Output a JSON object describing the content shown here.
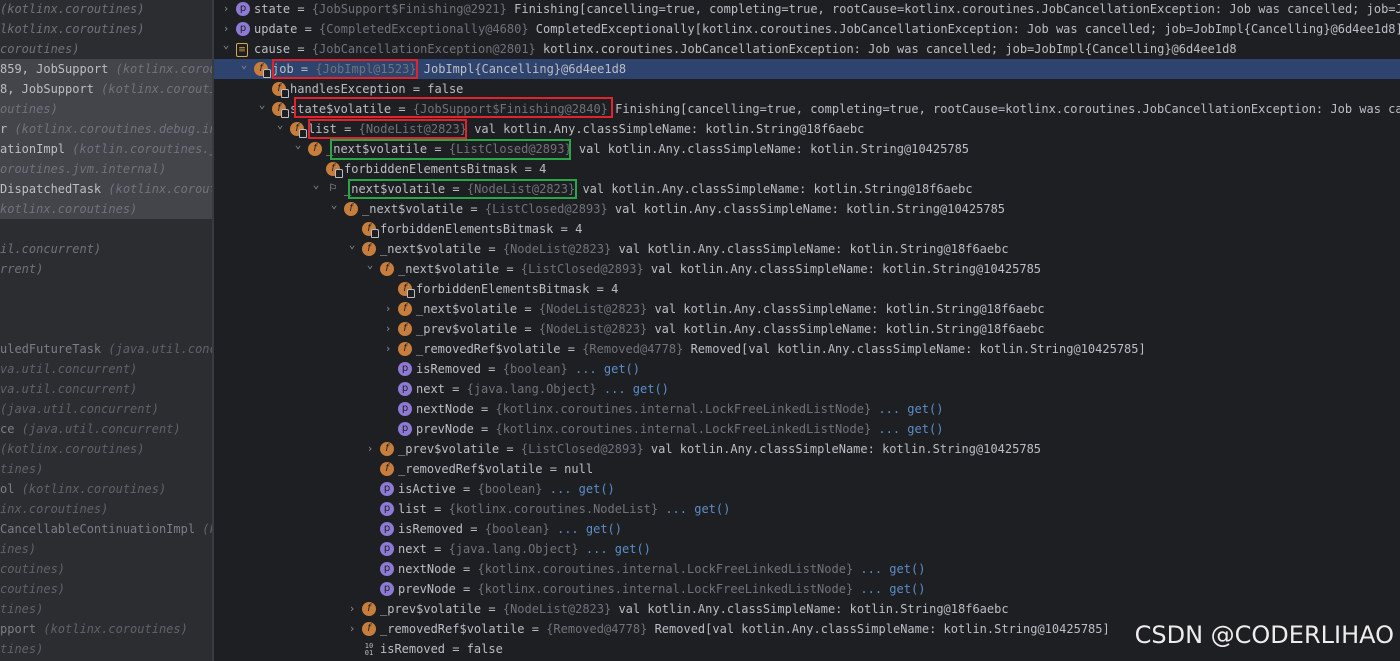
{
  "frames": [
    {
      "text": "",
      "pkg": "(kotlinx.coroutines)",
      "sel": false
    },
    {
      "text": "",
      "pkg": "lkotlinx.coroutines)",
      "sel": false
    },
    {
      "text": "",
      "pkg": "coroutines)",
      "sel": false
    },
    {
      "text": "859, JobSupport ",
      "pkg": "(kotlinx.corout",
      "sel": true
    },
    {
      "text": "8, JobSupport ",
      "pkg": "(kotlinx.corouti",
      "sel": true
    },
    {
      "text": "",
      "pkg": "outines)",
      "sel": true
    },
    {
      "text": "r ",
      "pkg": "(kotlinx.coroutines.debug.int",
      "sel": true
    },
    {
      "text": "ationImpl ",
      "pkg": "(kotlin.coroutines.jv",
      "sel": true
    },
    {
      "text": "",
      "pkg": "oroutines.jvm.internal)",
      "sel": true
    },
    {
      "text": " DispatchedTask ",
      "pkg": "(kotlinx.corout",
      "sel": true
    },
    {
      "text": "",
      "pkg": "kotlinx.coroutines)",
      "sel": true
    },
    {
      "text": "",
      "pkg": "",
      "sel": false
    },
    {
      "text": "",
      "pkg": "il.concurrent)",
      "sel": false
    },
    {
      "text": "",
      "pkg": "rrent)",
      "sel": false
    },
    {
      "text": "",
      "pkg": "",
      "sel": false
    },
    {
      "text": "",
      "pkg": "",
      "sel": false
    },
    {
      "text": "",
      "pkg": "",
      "sel": false
    },
    {
      "text": "uledFutureTask ",
      "pkg": "(java.util.concu",
      "sel": false,
      "lib": true
    },
    {
      "text": "",
      "pkg": "va.util.concurrent)",
      "sel": false,
      "lib": true
    },
    {
      "text": "",
      "pkg": "va.util.concurrent)",
      "sel": false,
      "lib": true
    },
    {
      "text": "",
      "pkg": "(java.util.concurrent)",
      "sel": false,
      "lib": true
    },
    {
      "text": "ce ",
      "pkg": "(java.util.concurrent)",
      "sel": false,
      "lib": true
    },
    {
      "text": " ",
      "pkg": "(kotlinx.coroutines)",
      "sel": false,
      "lib": true
    },
    {
      "text": "",
      "pkg": "tines)",
      "sel": false,
      "lib": true
    },
    {
      "text": "ol ",
      "pkg": "(kotlinx.coroutines)",
      "sel": false,
      "lib": true
    },
    {
      "text": "",
      "pkg": "inx.coroutines)",
      "sel": false,
      "lib": true
    },
    {
      "text": "CancellableContinuationImpl ",
      "pkg": "(ko",
      "sel": false,
      "lib": true
    },
    {
      "text": "",
      "pkg": "ines)",
      "sel": false,
      "lib": true
    },
    {
      "text": "",
      "pkg": "coutines)",
      "sel": false,
      "lib": true
    },
    {
      "text": "",
      "pkg": "coutines)",
      "sel": false,
      "lib": true
    },
    {
      "text": "",
      "pkg": "tines)",
      "sel": false,
      "lib": true
    },
    {
      "text": "pport ",
      "pkg": "(kotlinx.coroutines)",
      "sel": false,
      "lib": true
    },
    {
      "text": "",
      "pkg": "tines)",
      "sel": false,
      "lib": true
    }
  ],
  "rows": [
    {
      "lvl": 0,
      "arr": "›",
      "icon": "p",
      "name": "state",
      "type": "{JobSupport$Finishing@2921}",
      "val": " Finishing[cancelling=true, completing=true, rootCause=kotlinx.coroutines.JobCancellationException: Job was cancelled; job=JobImpl"
    },
    {
      "lvl": 0,
      "arr": "›",
      "icon": "p",
      "name": "update",
      "type": "{CompletedExceptionally@4680}",
      "val": " CompletedExceptionally[kotlinx.coroutines.JobCancellationException: Job was cancelled; job=JobImpl{Cancelling}@6d4ee1d8]"
    },
    {
      "lvl": 0,
      "arr": "⌄",
      "icon": "b",
      "name": "cause",
      "type": "{JobCancellationException@2801}",
      "val": " kotlinx.coroutines.JobCancellationException: Job was cancelled; job=JobImpl{Cancelling}@6d4ee1d8"
    },
    {
      "lvl": 1,
      "arr": "⌄",
      "icon": "fl",
      "name": "job",
      "type": "{JobImpl@1523}",
      "val": " JobImpl{Cancelling}@6d4ee1d8",
      "sel": true
    },
    {
      "lvl": 2,
      "arr": "",
      "icon": "fl",
      "name": "handlesException",
      "type": "",
      "val": " = false"
    },
    {
      "lvl": 2,
      "arr": "⌄",
      "icon": "fl",
      "name": "state$volatile",
      "type": "{JobSupport$Finishing@2840}",
      "val": " Finishing[cancelling=true, completing=true, rootCause=kotlinx.coroutines.JobCancellationException: Job was cance"
    },
    {
      "lvl": 3,
      "arr": "⌄",
      "icon": "fl",
      "name": "list",
      "type": "{NodeList@2823}",
      "val": " val kotlin.Any.classSimpleName: kotlin.String@18f6aebc"
    },
    {
      "lvl": 4,
      "arr": "⌄",
      "icon": "f",
      "name": "_next$volatile",
      "type": "{ListClosed@2893}",
      "val": " val kotlin.Any.classSimpleName: kotlin.String@10425785"
    },
    {
      "lvl": 5,
      "arr": "",
      "icon": "fl",
      "name": "forbiddenElementsBitmask",
      "type": "",
      "val": " = 4"
    },
    {
      "lvl": 5,
      "arr": "⌄",
      "icon": "flag",
      "name": "_next$volatile",
      "type": "{NodeList@2823}",
      "val": " val kotlin.Any.classSimpleName: kotlin.String@18f6aebc"
    },
    {
      "lvl": 6,
      "arr": "⌄",
      "icon": "f",
      "name": "_next$volatile",
      "type": "{ListClosed@2893}",
      "val": " val kotlin.Any.classSimpleName: kotlin.String@10425785"
    },
    {
      "lvl": 7,
      "arr": "",
      "icon": "fl",
      "name": "forbiddenElementsBitmask",
      "type": "",
      "val": " = 4"
    },
    {
      "lvl": 7,
      "arr": "⌄",
      "icon": "f",
      "name": "_next$volatile",
      "type": "{NodeList@2823}",
      "val": " val kotlin.Any.classSimpleName: kotlin.String@18f6aebc"
    },
    {
      "lvl": 8,
      "arr": "⌄",
      "icon": "f",
      "name": "_next$volatile",
      "type": "{ListClosed@2893}",
      "val": " val kotlin.Any.classSimpleName: kotlin.String@10425785"
    },
    {
      "lvl": 9,
      "arr": "",
      "icon": "fl",
      "name": "forbiddenElementsBitmask",
      "type": "",
      "val": " = 4"
    },
    {
      "lvl": 9,
      "arr": "›",
      "icon": "f",
      "name": "_next$volatile",
      "type": "{NodeList@2823}",
      "val": " val kotlin.Any.classSimpleName: kotlin.String@18f6aebc"
    },
    {
      "lvl": 9,
      "arr": "›",
      "icon": "f",
      "name": "_prev$volatile",
      "type": "{NodeList@2823}",
      "val": " val kotlin.Any.classSimpleName: kotlin.String@18f6aebc"
    },
    {
      "lvl": 9,
      "arr": "›",
      "icon": "f",
      "name": "_removedRef$volatile",
      "type": "{Removed@4778}",
      "val": " Removed[val kotlin.Any.classSimpleName: kotlin.String@10425785]"
    },
    {
      "lvl": 9,
      "arr": "",
      "icon": "p",
      "name": "isRemoved",
      "type": "{boolean}",
      "val": "",
      "get": " ... get()"
    },
    {
      "lvl": 9,
      "arr": "",
      "icon": "p",
      "name": "next",
      "type": "{java.lang.Object}",
      "val": "",
      "get": " ... get()"
    },
    {
      "lvl": 9,
      "arr": "",
      "icon": "p",
      "name": "nextNode",
      "type": "{kotlinx.coroutines.internal.LockFreeLinkedListNode}",
      "val": "",
      "get": " ... get()"
    },
    {
      "lvl": 9,
      "arr": "",
      "icon": "p",
      "name": "prevNode",
      "type": "{kotlinx.coroutines.internal.LockFreeLinkedListNode}",
      "val": "",
      "get": " ... get()"
    },
    {
      "lvl": 8,
      "arr": "›",
      "icon": "f",
      "name": "_prev$volatile",
      "type": "{ListClosed@2893}",
      "val": " val kotlin.Any.classSimpleName: kotlin.String@10425785"
    },
    {
      "lvl": 8,
      "arr": "",
      "icon": "f",
      "name": "_removedRef$volatile",
      "type": "",
      "val": " = null"
    },
    {
      "lvl": 8,
      "arr": "",
      "icon": "p",
      "name": "isActive",
      "type": "{boolean}",
      "val": "",
      "get": " ... get()"
    },
    {
      "lvl": 8,
      "arr": "",
      "icon": "p",
      "name": "list",
      "type": "{kotlinx.coroutines.NodeList}",
      "val": "",
      "get": " ... get()"
    },
    {
      "lvl": 8,
      "arr": "",
      "icon": "p",
      "name": "isRemoved",
      "type": "{boolean}",
      "val": "",
      "get": " ... get()"
    },
    {
      "lvl": 8,
      "arr": "",
      "icon": "p",
      "name": "next",
      "type": "{java.lang.Object}",
      "val": "",
      "get": " ... get()"
    },
    {
      "lvl": 8,
      "arr": "",
      "icon": "p",
      "name": "nextNode",
      "type": "{kotlinx.coroutines.internal.LockFreeLinkedListNode}",
      "val": "",
      "get": " ... get()"
    },
    {
      "lvl": 8,
      "arr": "",
      "icon": "p",
      "name": "prevNode",
      "type": "{kotlinx.coroutines.internal.LockFreeLinkedListNode}",
      "val": "",
      "get": " ... get()"
    },
    {
      "lvl": 7,
      "arr": "›",
      "icon": "f",
      "name": "_prev$volatile",
      "type": "{NodeList@2823}",
      "val": " val kotlin.Any.classSimpleName: kotlin.String@18f6aebc"
    },
    {
      "lvl": 7,
      "arr": "›",
      "icon": "f",
      "name": "_removedRef$volatile",
      "type": "{Removed@4778}",
      "val": " Removed[val kotlin.Any.classSimpleName: kotlin.String@10425785]"
    },
    {
      "lvl": 7,
      "arr": "",
      "icon": "bin",
      "name": "isRemoved",
      "type": "",
      "val": " = false"
    }
  ],
  "watermark": "CSDN @CODERLIHAO",
  "colors": {
    "highlight_red": "#e0242d",
    "highlight_green": "#2aa548",
    "selected_row": "#2e436e"
  }
}
